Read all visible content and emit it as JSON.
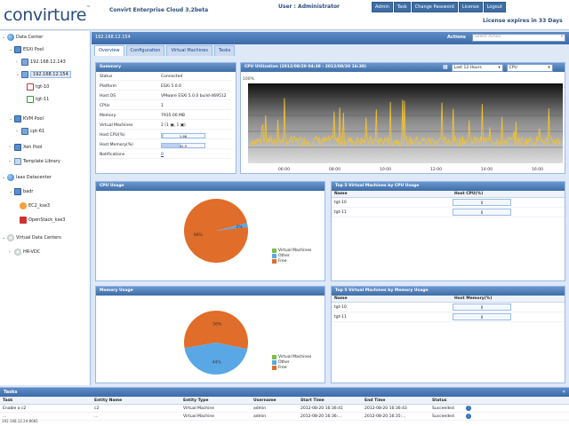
{
  "header": {
    "logo": "convirture",
    "product": "Convirt Enterprise Cloud 3.2beta",
    "user": "User : Administrator",
    "nav": [
      "Admin",
      "Task",
      "Change Password",
      "License",
      "Logout"
    ],
    "license": "License expires in 33 Days"
  },
  "sidebar": {
    "items": [
      {
        "label": "Data Center"
      },
      {
        "label": "ESXi Pool"
      },
      {
        "label": "192.168.12.143"
      },
      {
        "label": "192.168.12.154"
      },
      {
        "label": "tgt-10"
      },
      {
        "label": "tgt-11"
      },
      {
        "label": "KVM Pool"
      },
      {
        "label": "cpt-61"
      },
      {
        "label": "Xen Pool"
      },
      {
        "label": "Template Library"
      },
      {
        "label": "Iaas Datacenter"
      },
      {
        "label": "badr"
      },
      {
        "label": "EC2_kse3"
      },
      {
        "label": "OpenStack_kse3"
      },
      {
        "label": "Virtual Data Centers"
      },
      {
        "label": "HR-VDC"
      }
    ]
  },
  "main": {
    "title": "192.168.12.154",
    "actions_label": "Actions",
    "actions_placeholder": "Select Action",
    "tabs": [
      "Overview",
      "Configuration",
      "Virtual Machines",
      "Tasks"
    ]
  },
  "summary": {
    "title": "Summary",
    "rows": [
      {
        "k": "Status",
        "v": "Connected"
      },
      {
        "k": "Platform",
        "v": "ESXi 5.0.0"
      },
      {
        "k": "Host OS",
        "v": "VMware ESXi 5.0.0 build-469512"
      },
      {
        "k": "CPUs",
        "v": "1"
      },
      {
        "k": "Memory",
        "v": "7935.00 MB"
      },
      {
        "k": "Virtual Machines",
        "v": "2 (1 ▣, 1 ▣)"
      },
      {
        "k": "Host CPU(%)",
        "v": "1.86",
        "bar": 0.04
      },
      {
        "k": "Host Memory(%)",
        "v": "42.5",
        "bar": 0.43
      },
      {
        "k": "Notifications",
        "v": "0"
      }
    ]
  },
  "cpu_chart": {
    "title": "CPU Utilization (2012/08/20 04:38 - 2012/08/20 16:38)",
    "range": "Last 12 Hours",
    "metric": "CPU",
    "ylabel": "100%",
    "xticks": [
      "06:00",
      "08:00",
      "10:00",
      "12:00",
      "14:00",
      "16:00"
    ]
  },
  "cpu_usage": {
    "title": "CPU Usage",
    "slices": [
      {
        "label": "98%",
        "value": 98,
        "color": "#e06d2a"
      },
      {
        "label": "2%",
        "value": 2,
        "color": "#5aa7e6"
      }
    ],
    "legend": [
      {
        "label": "Virtual Machines",
        "color": "#7ac142"
      },
      {
        "label": "Other",
        "color": "#5aa7e6"
      },
      {
        "label": "Free",
        "color": "#e06d2a"
      }
    ]
  },
  "top_cpu": {
    "title": "Top 5 Virtual Machines by CPU Usage",
    "col_name": "Name",
    "col_value": "Host CPU(%)",
    "rows": [
      {
        "name": "tgt-10",
        "value": "0"
      },
      {
        "name": "tgt-11",
        "value": "0"
      }
    ]
  },
  "memory_usage": {
    "title": "Memory Usage",
    "slices": [
      {
        "label": "56%",
        "value": 56,
        "color": "#e06d2a"
      },
      {
        "label": "44%",
        "value": 44,
        "color": "#5aa7e6"
      }
    ],
    "legend": [
      {
        "label": "Virtual Machines",
        "color": "#7ac142"
      },
      {
        "label": "Other",
        "color": "#5aa7e6"
      },
      {
        "label": "Free",
        "color": "#e06d2a"
      }
    ]
  },
  "top_mem": {
    "title": "Top 5 Virtual Machines by Memory Usage",
    "col_name": "Name",
    "col_value": "Host Memory(%)",
    "rows": [
      {
        "name": "tgt-10",
        "value": "0"
      },
      {
        "name": "tgt-11",
        "value": "0"
      }
    ]
  },
  "tasks": {
    "title": "Tasks",
    "cols": [
      "Task",
      "Entity Name",
      "Entity Type",
      "Username",
      "Start Time",
      "End Time",
      "Status"
    ],
    "rows": [
      [
        "Enable a c2",
        "c2",
        "Virtual Machine",
        "admin",
        "2012-08-20 16:36:41",
        "2012-08-20 16:36:43",
        "Succeeded"
      ],
      [
        "...",
        "...",
        "Virtual Machine",
        "admin",
        "2012-08-20 16:36:...",
        "2012-08-20 16:35:...",
        "Succeeded"
      ]
    ]
  },
  "status_ip": "192.168.12.24:8081"
}
